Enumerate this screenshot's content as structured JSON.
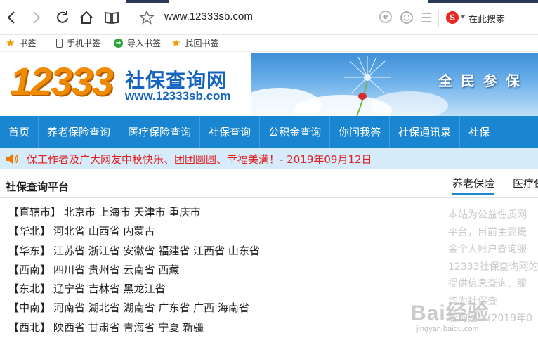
{
  "browser": {
    "url": "www.12333sb.com",
    "search_placeholder": "在此搜索",
    "search_engine_letter": "S",
    "compat_letter": "e"
  },
  "bookmarks": {
    "items": [
      {
        "label": "书签",
        "icon": "star-icon"
      },
      {
        "label": "手机书签",
        "icon": "phone-icon"
      },
      {
        "label": "导入书签",
        "icon": "import-icon"
      },
      {
        "label": "找回书签",
        "icon": "star-icon"
      }
    ]
  },
  "header": {
    "logo_number": "12333",
    "logo_name": "社保查询网",
    "logo_url": "www.12333sb.com",
    "banner_text": "全民参保"
  },
  "nav": {
    "items": [
      "首页",
      "养老保险查询",
      "医疗保险查询",
      "社保查询",
      "公积金查询",
      "你问我答",
      "社保通讯录",
      "社保"
    ]
  },
  "notice": {
    "text": "保工作者及广大网友中秋快乐、团团圆圆、幸福美满！- 2019年09月12日"
  },
  "main": {
    "title": "社保查询平台",
    "regions": [
      {
        "tag": "【直辖市】",
        "places": "北京市 上海市 天津市 重庆市"
      },
      {
        "tag": "【华北】",
        "places": "河北省 山西省 内蒙古"
      },
      {
        "tag": "【华东】",
        "places": "江苏省 浙江省 安徽省 福建省 江西省 山东省"
      },
      {
        "tag": "【西南】",
        "places": "四川省 贵州省 云南省 西藏"
      },
      {
        "tag": "【东北】",
        "places": "辽宁省 吉林省 黑龙江省"
      },
      {
        "tag": "【中南】",
        "places": "河南省 湖北省 湖南省 广东省 广西 海南省"
      },
      {
        "tag": "【西北】",
        "places": "陕西省 甘肃省 青海省 宁夏 新疆"
      }
    ]
  },
  "side": {
    "tabs": [
      "养老保险",
      "医疗保"
    ],
    "lines": [
      "本站为公益性质网",
      "平台，目前主要提",
      "金个人帐户查询服",
      "12333社保查询网的",
      "提供信息查询、服",
      "均为社保查",
      "查询网！(2019年0"
    ]
  },
  "watermark": {
    "main": "Bai经验",
    "sub": "jingyan.baidu.com"
  }
}
